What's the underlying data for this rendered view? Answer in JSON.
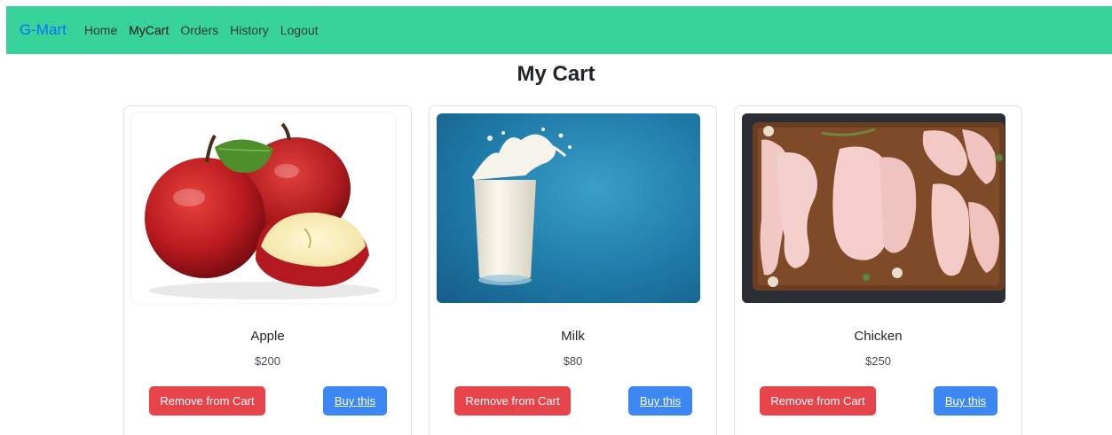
{
  "navbar": {
    "brand": "G-Mart",
    "links": [
      "Home",
      "MyCart",
      "Orders",
      "History",
      "Logout"
    ]
  },
  "page": {
    "title": "My Cart"
  },
  "products": [
    {
      "name": "Apple",
      "price": "$200",
      "remove_label": "Remove from Cart",
      "buy_label": "Buy this"
    },
    {
      "name": "Milk",
      "price": "$80",
      "remove_label": "Remove from Cart",
      "buy_label": "Buy this"
    },
    {
      "name": "Chicken",
      "price": "$250",
      "remove_label": "Remove from Cart",
      "buy_label": "Buy this"
    }
  ],
  "colors": {
    "navbar": "#38d39b",
    "brand": "#0d6efd",
    "remove_button": "#e7434a",
    "buy_button": "#3d87f5"
  }
}
